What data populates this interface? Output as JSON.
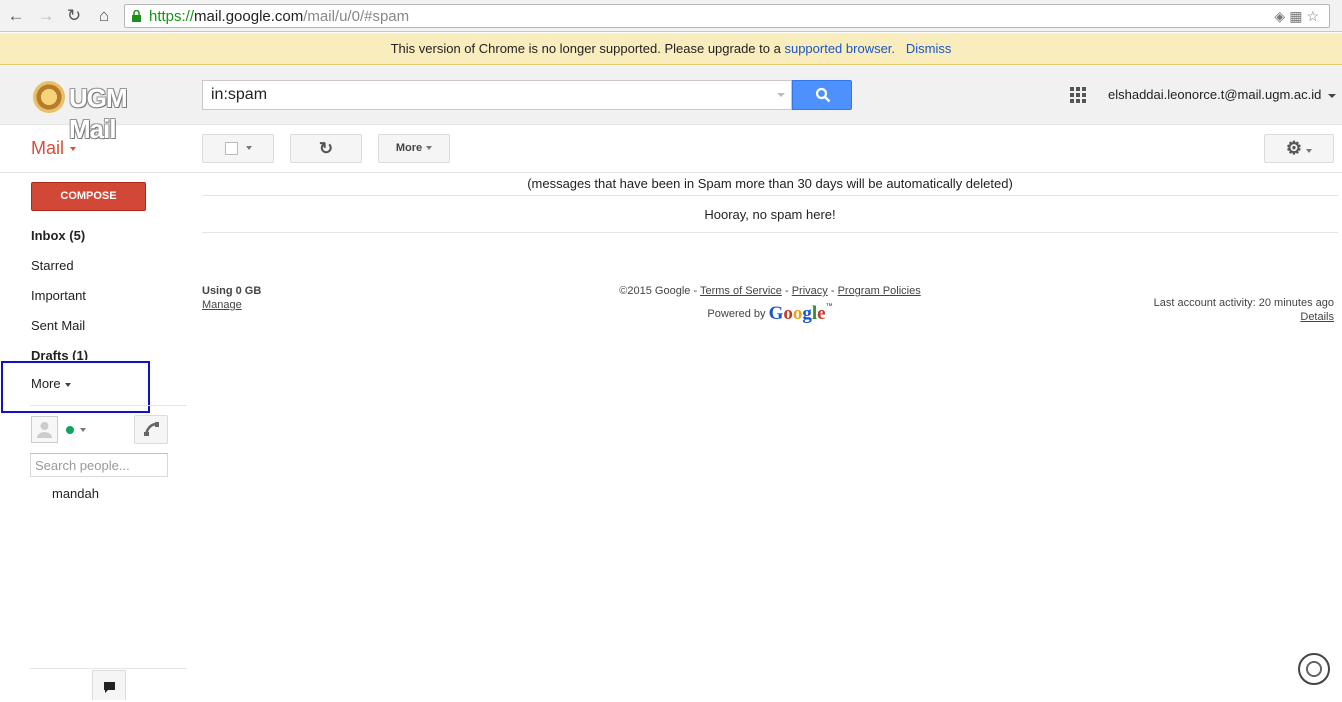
{
  "browser": {
    "url_scheme": "https://",
    "url_host": "mail.google.com",
    "url_path": "/mail/u/0/#spam",
    "icons": [
      "back-icon",
      "forward-icon",
      "reload-icon",
      "home-icon",
      "lock-icon",
      "extension-icon",
      "translate-icon",
      "star-icon"
    ]
  },
  "infobar": {
    "message": "This version of Chrome is no longer supported. Please upgrade to a",
    "link_label": "supported browser.",
    "dismiss_label": "Dismiss"
  },
  "header": {
    "logo_text": "UGM Mail",
    "search_value": "in:spam",
    "account_email": "elshaddai.leonorce.t@mail.ugm.ac.id"
  },
  "toolbar": {
    "mail_label": "Mail",
    "more_label": "More"
  },
  "sidebar": {
    "compose_label": "COMPOSE",
    "items": [
      {
        "label": "Inbox (5)",
        "bold": true
      },
      {
        "label": "Starred",
        "bold": false
      },
      {
        "label": "Important",
        "bold": false
      },
      {
        "label": "Sent Mail",
        "bold": false
      },
      {
        "label": "Drafts (1)",
        "bold": true
      }
    ],
    "more_label": "More",
    "people_search_placeholder": "Search people...",
    "contact_name": "mandah"
  },
  "main": {
    "spam_note": "(messages that have been in Spam more than 30 days will be automatically deleted)",
    "empty_message": "Hooray, no spam here!"
  },
  "footer": {
    "usage": "Using 0 GB",
    "manage_label": "Manage",
    "copyright": "©2015 Google -",
    "terms_label": "Terms of Service",
    "sep": "-",
    "privacy_label": "Privacy",
    "policies_label": "Program Policies",
    "powered_by": "Powered by",
    "google_logo": "Google",
    "last_activity": "Last account activity: 20 minutes ago",
    "details_label": "Details"
  },
  "colors": {
    "compose_red": "#d14836",
    "mail_red": "#dd4b39",
    "search_blue": "#4d90fe",
    "infobar_yellow": "#f9edbe",
    "highlight_blue": "#1010c8"
  }
}
